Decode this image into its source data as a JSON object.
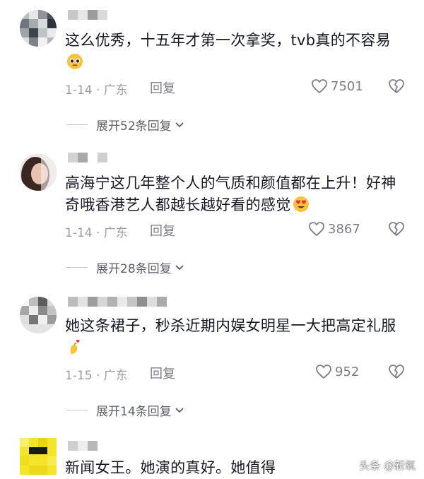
{
  "comments": [
    {
      "text": "这么优秀，十五年才第一次拿奖，tvb真的不容易",
      "emoji": "pleading-face",
      "date_location": "1-14 · 广东",
      "reply_label": "回复",
      "likes": "7501",
      "expand_label": "展开52条回复"
    },
    {
      "text": "高海宁这几年整个人的气质和颜值都在上升！好神奇哦香港艺人都越长越好看的感觉",
      "emoji": "heart-eyes-face",
      "date_location": "1-14 · 广东",
      "reply_label": "回复",
      "likes": "3867",
      "expand_label": "展开28条回复"
    },
    {
      "text": "她这条裙子，秒杀近期内娱女明星一大把高定礼服",
      "emoji": "finger-heart",
      "date_location": "1-15 · 广东",
      "reply_label": "回复",
      "likes": "952",
      "expand_label": "展开14条回复"
    },
    {
      "text": "新闻女王。她演的真好。她值得"
    }
  ],
  "watermark": "头条 @新氧",
  "colors": {
    "text": "#161823",
    "meta": "#9a9ca4",
    "expand": "#5b5e68"
  }
}
